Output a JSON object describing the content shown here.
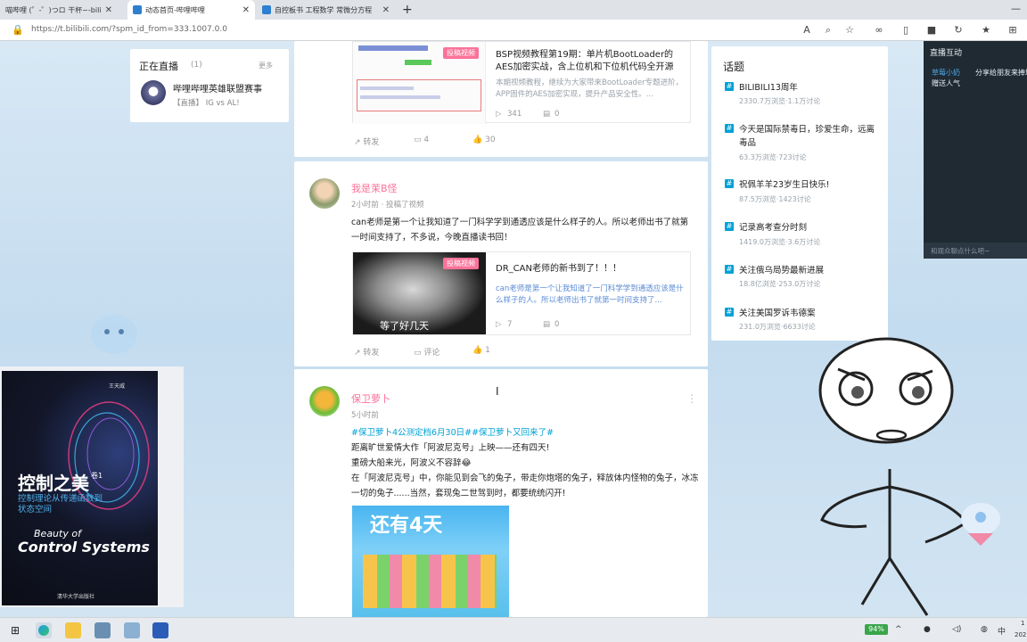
{
  "browser": {
    "tabs": [
      {
        "label": "喵哔哩 (゜-゜)つロ 干杯~-bili"
      },
      {
        "label": "动态首页-哔哩哔哩"
      },
      {
        "label": "自控板书 工程数学 常微分方程"
      }
    ],
    "new_tab": "+",
    "url": "https://t.bilibili.com/?spm_id_from=333.1007.0.0"
  },
  "live": {
    "title": "正在直播",
    "count": "(1)",
    "more": "更多",
    "name": "哔哩哔哩英雄联盟赛事",
    "subtitle": "【直播】 IG vs AL!"
  },
  "posts": [
    {
      "video": {
        "badge": "投稿视频",
        "title": "BSP视频教程第19期：单片机BootLoader的AES加密实战，含上位机和下位机代码全开源",
        "desc": "本期视频教程，继续为大家带来BootLoader专题进阶，APP固件的AES加密实现，提升产品安全性。...",
        "views": "341",
        "comments": "0"
      },
      "actions": {
        "share": "转发",
        "comment": "4",
        "like": "30"
      }
    },
    {
      "user": "我是茉B怪",
      "meta": "2小时前 · 投稿了视频",
      "text": "can老师是第一个让我知道了一门科学学到通透应该是什么样子的人。所以老师出书了就第一时间支持了，不多说，今晚直播读书回！",
      "video": {
        "badge": "投稿视频",
        "thumb_caption": "等了好几天",
        "title": "DR_CAN老师的新书到了！！！",
        "desc": "can老师是第一个让我知道了一门科学学到通透应该是什么样子的人。所以老师出书了就第一时间支持了...",
        "views": "7",
        "comments": "0"
      },
      "actions": {
        "share": "转发",
        "comment": "评论",
        "like": "1"
      }
    },
    {
      "user": "保卫萝卜",
      "meta": "5小时前",
      "tags": "#保卫萝卜4公测定档6月30日##保卫萝卜又回来了#",
      "lines": [
        "距离旷世爱情大作「阿波尼克号」上映——还有四天!",
        "重磅大船来光，阿波义不容辞😂",
        "在「阿波尼克号」中，你能见到会飞的兔子，带走你炮塔的兔子，释放体内怪物的兔子，冰冻一切的兔子......当然，套现兔二世驾到时，都要统统闪开!"
      ],
      "image_text": "还有4天"
    }
  ],
  "topics": {
    "title": "话题",
    "items": [
      {
        "title": "BILIBILI13周年",
        "stats": "2330.7万浏览·1.1万讨论"
      },
      {
        "title": "今天是国际禁毒日，珍爱生命，远离毒品",
        "stats": "63.3万浏览·723讨论"
      },
      {
        "title": "祝佩羊羊23岁生日快乐!",
        "stats": "87.5万浏览·1423讨论"
      },
      {
        "title": "记录高考查分时刻",
        "stats": "1419.0万浏览·3.6万讨论"
      },
      {
        "title": "关注俄乌局势最新进展",
        "stats": "18.8亿浏览·253.0万讨论"
      },
      {
        "title": "关注美国罗诉韦德案",
        "stats": "231.0万浏览·6633讨论"
      }
    ]
  },
  "chat": {
    "title": "直播互动",
    "msg_user": "草莓小奶",
    "msg_text": "分享给朋友来捧场",
    "msg_sub": "赠送人气",
    "input_placeholder": "和观众聊点什么吧~"
  },
  "book": {
    "title": "控制之美",
    "volume": "卷1",
    "subtitle": "控制理论从传递函数到状态空间",
    "en_line1": "Beauty of",
    "en_line2": "Control Systems",
    "author": "王天威",
    "publisher": "清华大学出版社"
  },
  "taskbar": {
    "battery": "94%",
    "ime": "中",
    "time": "1",
    "date": "202"
  }
}
